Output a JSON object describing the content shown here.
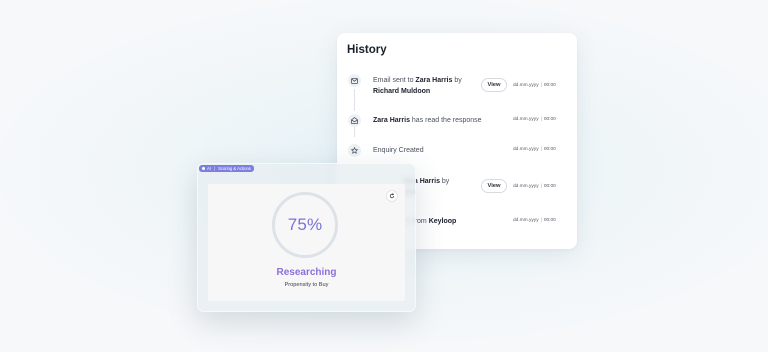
{
  "history": {
    "title": "History",
    "events": [
      {
        "icon": "mail-icon",
        "text_prefix": "Email sent to ",
        "bold_name": "Zara Harris",
        "text_mid": " by",
        "bold_line2": "Richard Muldoon",
        "view_label": "View",
        "date": "dd.mm.yyyy",
        "time": "00:00"
      },
      {
        "icon": "mail-open-icon",
        "bold_name": "Zara Harris",
        "text_suffix": " has read the response",
        "date": "dd.mm.yyyy",
        "time": "00:00"
      },
      {
        "icon": "star-icon",
        "text": "Enquiry Created",
        "date": "dd.mm.yyyy",
        "time": "00:00"
      },
      {
        "icon": "mail-icon",
        "bold_name": "Zara Harris",
        "text_mid": " by",
        "bold_line2": "oon",
        "view_label": "View",
        "date": "dd.mm.yyyy",
        "time": "00:00"
      },
      {
        "icon": "import-icon",
        "text_prefix": "ed from ",
        "bold_name": "Keyloop",
        "date": "dd.mm.yyyy",
        "time": "00:00"
      }
    ]
  },
  "scoring": {
    "badge_ai": "AI",
    "badge_label": "Scoring & Actions",
    "percent": "75%",
    "percent_value": 0.75,
    "stage": "Researching",
    "subtitle": "Propensity to Buy"
  },
  "colors": {
    "accent_purple": "#7b72d6",
    "stage_purple": "#8c70d9",
    "badge_bg": "#7c7fe0"
  }
}
